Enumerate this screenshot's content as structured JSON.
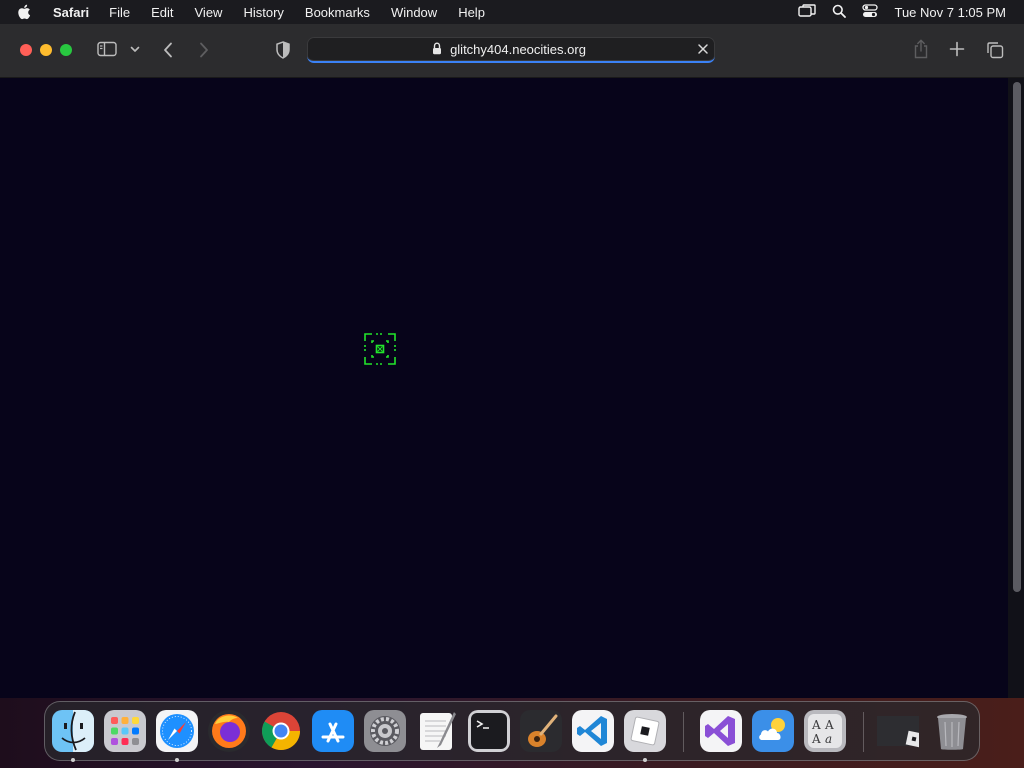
{
  "menubar": {
    "app_name": "Safari",
    "menus": [
      "File",
      "Edit",
      "View",
      "History",
      "Bookmarks",
      "Window",
      "Help"
    ],
    "clock": "Tue Nov 7  1:05 PM"
  },
  "toolbar": {
    "url": "glitchy404.neocities.org"
  },
  "icons": {
    "apple": "apple-logo-icon",
    "screen_mirroring": "screen-mirroring-icon",
    "spotlight": "search-icon",
    "control_center": "control-center-icon",
    "sidebar": "sidebar-icon",
    "back": "chevron-left-icon",
    "forward": "chevron-right-icon",
    "privacy": "shield-icon",
    "share": "share-icon",
    "new_tab": "plus-icon",
    "tab_overview": "tabs-icon"
  },
  "colors": {
    "page_background": "#07041a",
    "glitch_green": "#22e52b",
    "url_focus": "#3b82f6"
  }
}
